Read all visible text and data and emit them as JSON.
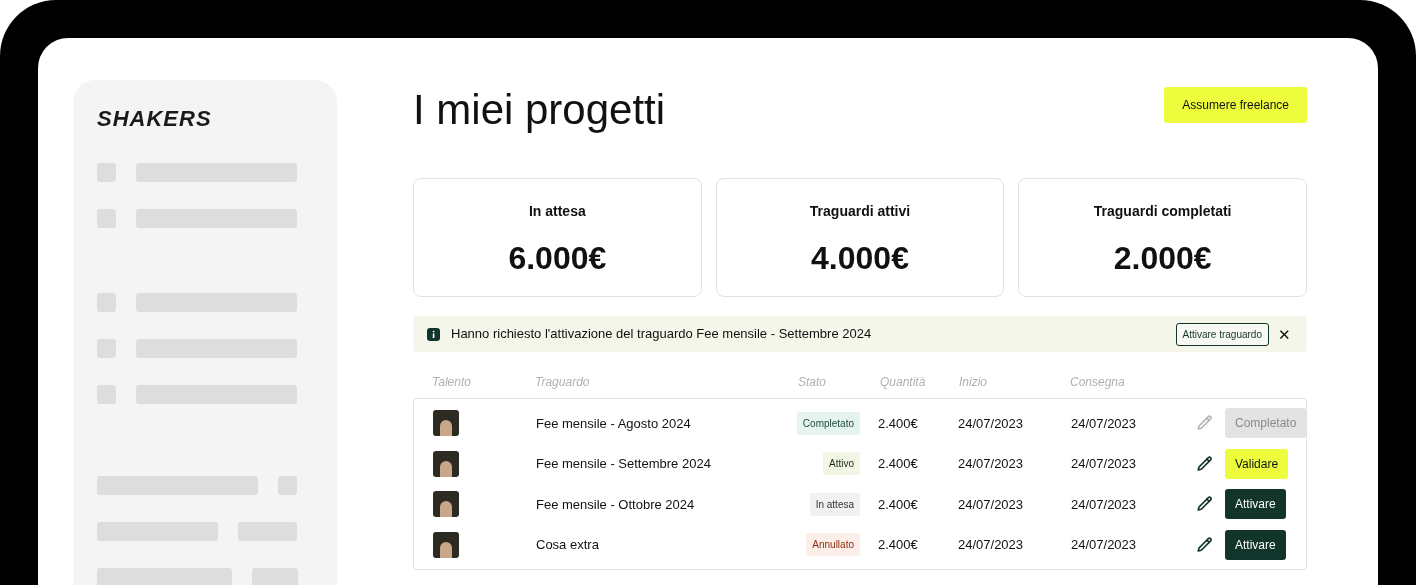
{
  "logo": "SHAKERS",
  "page": {
    "title": "I miei progetti",
    "primary_button": "Assumere freelance"
  },
  "stats": [
    {
      "label": "In attesa",
      "value": "6.000€"
    },
    {
      "label": "Traguardi attivi",
      "value": "4.000€"
    },
    {
      "label": "Traguardi completati",
      "value": "2.000€"
    }
  ],
  "notice": {
    "text": "Hanno richiesto l'attivazione del traguardo Fee mensile - Settembre 2024",
    "button": "Attivare traguardo",
    "close": "✕"
  },
  "table": {
    "columns": [
      "Talento",
      "Traguardo",
      "Stato",
      "Quantità",
      "Inizio",
      "Consegna"
    ],
    "rows": [
      {
        "milestone": "Fee mensile - Agosto 2024",
        "status": {
          "label": "Completato",
          "kind": "completed"
        },
        "amount": "2.400€",
        "start": "24/07/2023",
        "delivery": "24/07/2023",
        "action": {
          "label": "Completato",
          "kind": "muted"
        }
      },
      {
        "milestone": "Fee mensile - Settembre 2024",
        "status": {
          "label": "Attivo",
          "kind": "active"
        },
        "amount": "2.400€",
        "start": "24/07/2023",
        "delivery": "24/07/2023",
        "action": {
          "label": "Validare",
          "kind": "accent"
        }
      },
      {
        "milestone": "Fee mensile - Ottobre 2024",
        "status": {
          "label": "In attesa",
          "kind": "pending"
        },
        "amount": "2.400€",
        "start": "24/07/2023",
        "delivery": "24/07/2023",
        "action": {
          "label": "Attivare",
          "kind": "primary"
        }
      },
      {
        "milestone": "Cosa extra",
        "status": {
          "label": "Annullato",
          "kind": "cancelled"
        },
        "amount": "2.400€",
        "start": "24/07/2023",
        "delivery": "24/07/2023",
        "action": {
          "label": "Attivare",
          "kind": "primary"
        }
      }
    ]
  }
}
